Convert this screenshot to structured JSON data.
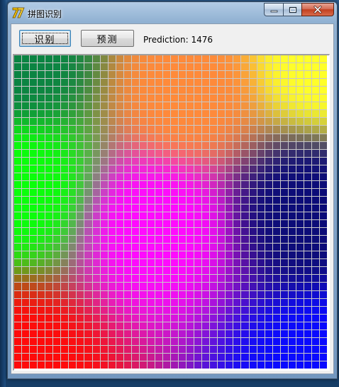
{
  "window": {
    "title": "拼图识别",
    "icon": "app-logo-icon"
  },
  "toolbar": {
    "recognize_label": "识别",
    "predict_label": "预测",
    "prediction_text": "Prediction: 1476"
  },
  "mosaic": {
    "rows": 40,
    "cols": 40,
    "corner_colors": {
      "top_left": "#0b8442",
      "top_right": "#ffff2a",
      "bottom_left": "#ff0a0a",
      "bottom_right": "#0a0aff",
      "middle_left": "#0aff0a",
      "center": "#ff0aff",
      "top_center": "#ff8a3a",
      "right_middle": "#0c0c78"
    }
  }
}
